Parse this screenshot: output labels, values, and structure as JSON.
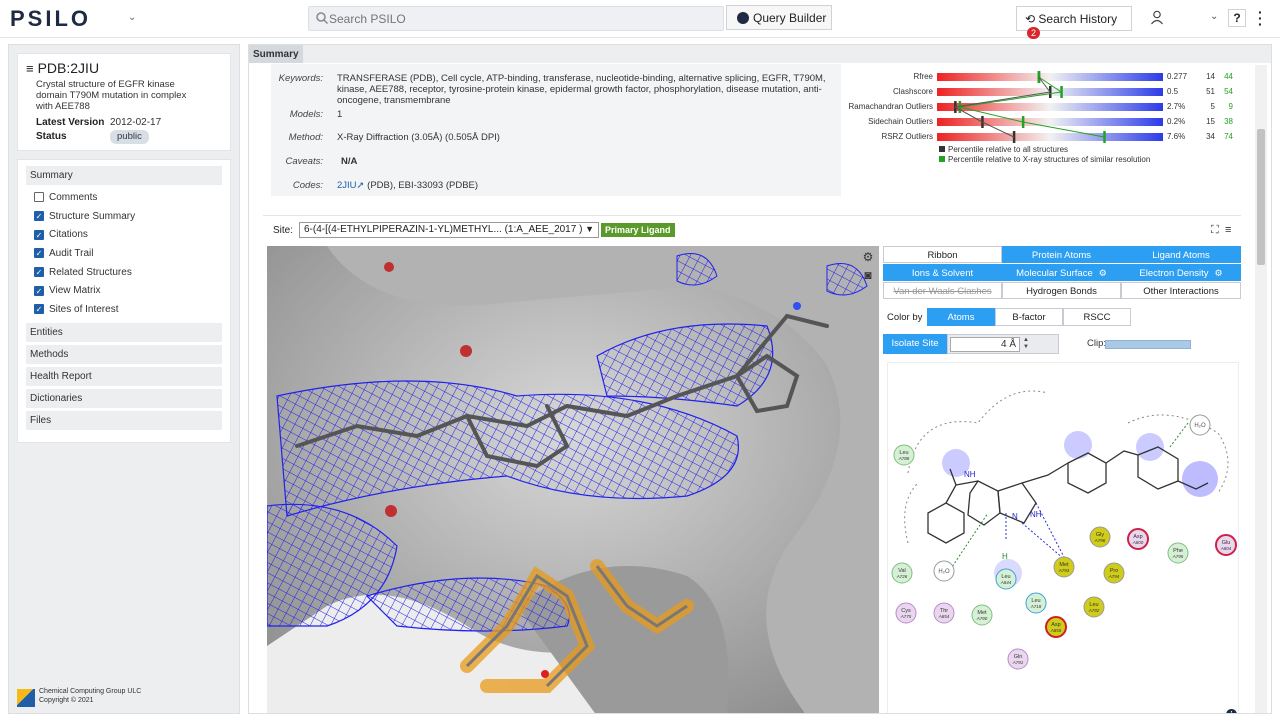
{
  "header": {
    "logo": "PSILO",
    "search_placeholder": "Search PSILO",
    "query_builder": "Query Builder",
    "search_history": "Search History",
    "history_count": "2",
    "help": "?"
  },
  "entry": {
    "id": "PDB:2JIU",
    "description": "Crystal structure of EGFR kinase domain T790M mutation in complex with AEE788",
    "latest_version_label": "Latest Version",
    "latest_version": "2012-02-17",
    "status_label": "Status",
    "status": "public"
  },
  "nav": {
    "summary": "Summary",
    "checks": [
      {
        "label": "Comments",
        "checked": false
      },
      {
        "label": "Structure Summary",
        "checked": true
      },
      {
        "label": "Citations",
        "checked": true
      },
      {
        "label": "Audit Trail",
        "checked": true
      },
      {
        "label": "Related Structures",
        "checked": true
      },
      {
        "label": "View Matrix",
        "checked": true
      },
      {
        "label": "Sites of Interest",
        "checked": true
      }
    ],
    "sections": [
      "Entities",
      "Methods",
      "Health Report",
      "Dictionaries",
      "Files"
    ]
  },
  "footer": {
    "company": "Chemical Computing Group ULC",
    "copyright": "Copyright © 2021"
  },
  "tab": "Summary",
  "summary": {
    "keywords_label": "Keywords:",
    "keywords": "TRANSFERASE (PDB), Cell cycle, ATP-binding, transferase, nucleotide-binding, alternative splicing, EGFR, T790M, kinase, AEE788, receptor, tyrosine-protein kinase, epidermal growth factor, phosphorylation, disease mutation, anti-oncogene, transmembrane",
    "models_label": "Models:",
    "models": "1",
    "method_label": "Method:",
    "method": "X-Ray Diffraction (3.05Å) (0.505Å DPI)",
    "caveats_label": "Caveats:",
    "caveats": "N/A",
    "codes_label": "Codes:",
    "codes_link": "2JIU",
    "codes_rest": " (PDB), EBI-33093 (PDBE)"
  },
  "validation": {
    "metrics": [
      {
        "name": "Rfree",
        "value": "0.277",
        "all": "14",
        "xray": "44"
      },
      {
        "name": "Clashscore",
        "value": "0.5",
        "all": "51",
        "xray": "54"
      },
      {
        "name": "Ramachandran Outliers",
        "value": "2.7%",
        "all": "5",
        "xray": "9"
      },
      {
        "name": "Sidechain Outliers",
        "value": "0.2%",
        "all": "15",
        "xray": "38"
      },
      {
        "name": "RSRZ Outliers",
        "value": "7.6%",
        "all": "34",
        "xray": "74"
      }
    ],
    "legend_all": "Percentile relative to all structures",
    "legend_xray": "Percentile relative to X-ray structures of similar resolution",
    "color_all": "#333333",
    "color_xray": "#22a322"
  },
  "viewer": {
    "site_label": "Site:",
    "site_value": "6-(4-[(4-ETHYLPIPERAZIN-1-YL)METHYL... (1:A_AEE_2017 )",
    "primary_ligand": "Primary Ligand",
    "display_buttons": [
      {
        "label": "Ribbon",
        "on": false,
        "gear": false,
        "strike": false
      },
      {
        "label": "Protein Atoms",
        "on": true,
        "gear": false,
        "strike": false
      },
      {
        "label": "Ligand Atoms",
        "on": true,
        "gear": false,
        "strike": false
      },
      {
        "label": "Ions & Solvent",
        "on": true,
        "gear": false,
        "strike": false
      },
      {
        "label": "Molecular Surface",
        "on": true,
        "gear": true,
        "strike": false
      },
      {
        "label": "Electron Density",
        "on": true,
        "gear": true,
        "strike": false
      },
      {
        "label": "Van der Waals Clashes",
        "on": false,
        "gear": false,
        "strike": true
      },
      {
        "label": "Hydrogen Bonds",
        "on": false,
        "gear": false,
        "strike": false
      },
      {
        "label": "Other Interactions",
        "on": false,
        "gear": false,
        "strike": false
      }
    ],
    "color_by_label": "Color by",
    "color_by": [
      {
        "label": "Atoms",
        "on": true
      },
      {
        "label": "B-factor",
        "on": false
      },
      {
        "label": "RSCC",
        "on": false
      }
    ],
    "isolate_site": "Isolate Site",
    "isolate_value": "4 Å",
    "clip_label": "Clip:",
    "accent": "#2d9ff2"
  },
  "residues": [
    {
      "name": "Leu",
      "num": "A788"
    },
    {
      "name": "Val",
      "num": "A726"
    },
    {
      "name": "Cys",
      "num": "A775"
    },
    {
      "name": "Thr",
      "num": "A854"
    },
    {
      "name": "Met",
      "num": "A790"
    },
    {
      "name": "Leu",
      "num": "A844"
    },
    {
      "name": "Leu",
      "num": "A718"
    },
    {
      "name": "Asp",
      "num": "A855"
    },
    {
      "name": "Met",
      "num": "A793"
    },
    {
      "name": "Gly",
      "num": "A796"
    },
    {
      "name": "Pro",
      "num": "A794"
    },
    {
      "name": "Leu",
      "num": "A792"
    },
    {
      "name": "Asp",
      "num": "A800"
    },
    {
      "name": "Phe",
      "num": "A795"
    },
    {
      "name": "Glu",
      "num": "A804"
    },
    {
      "name": "Gln",
      "num": "A791"
    }
  ],
  "water_label": "H₂O",
  "nh_label": "NH",
  "n_label": "N",
  "nh_right": "NH",
  "h_label": "H"
}
